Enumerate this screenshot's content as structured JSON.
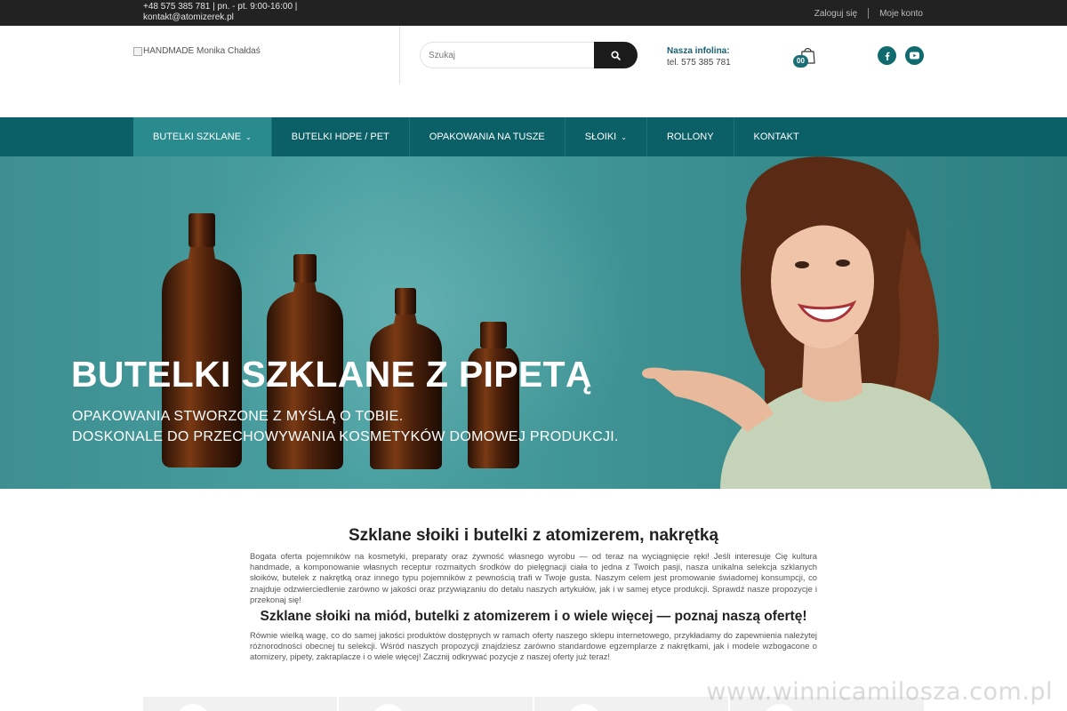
{
  "topbar": {
    "contact_line1": "+48 575 385 781 | pn. - pt. 9:00-16:00 |",
    "contact_line2": "kontakt@atomizerek.pl",
    "login": "Zaloguj się",
    "account": "Moje konto"
  },
  "header": {
    "logo_alt": "HANDMADE Monika Chałdaś",
    "search_placeholder": "Szukaj",
    "infolina_label": "Nasza infolina:",
    "infolina_phone": "tel. 575 385 781",
    "cart_count": "00",
    "social": [
      "facebook-icon",
      "youtube-icon"
    ]
  },
  "nav": {
    "items": [
      {
        "label": "BUTELKI SZKLANE",
        "has_dropdown": true,
        "active": true
      },
      {
        "label": "BUTELKI HDPE / PET",
        "has_dropdown": false,
        "active": false
      },
      {
        "label": "OPAKOWANIA NA TUSZE",
        "has_dropdown": false,
        "active": false
      },
      {
        "label": "SŁOIKI",
        "has_dropdown": true,
        "active": false
      },
      {
        "label": "ROLLONY",
        "has_dropdown": false,
        "active": false
      },
      {
        "label": "KONTAKT",
        "has_dropdown": false,
        "active": false
      }
    ]
  },
  "hero": {
    "title": "BUTELKI SZKLANE Z PIPETĄ",
    "subtitle_line1": "OPAKOWANIA STWORZONE Z MYŚLĄ O TOBIE.",
    "subtitle_line2": "DOSKONALE DO PRZECHOWYWANIA KOSMETYKÓW DOMOWEJ PRODUKCJI."
  },
  "content": {
    "heading": "Szklane słoiki i butelki z atomizerem, nakrętką",
    "paragraph1": "Bogata oferta pojemników na kosmetyki, preparaty oraz żywność własnego wyrobu — od teraz na wyciągnięcie ręki! Jeśli interesuje Cię kultura handmade, a komponowanie własnych receptur rozmaitych środków do pielęgnacji ciała to jedna z Twoich pasji, nasza unikalna selekcja szklanych słoików, butelek z nakrętką oraz innego typu pojemników z pewnością trafi w Twoje gusta. Naszym celem jest promowanie świadomej konsumpcji, co znajduje odzwierciedlenie zarówno w jakości oraz przywiązaniu do detalu naszych artykułów, jak i w samej etyce produkcji. Sprawdź nasze propozycje i przekonaj się!",
    "subheading": "Szklane słoiki na miód, butelki z atomizerem i o wiele więcej — poznaj naszą ofertę!",
    "paragraph2": "Równie wielką wagę, co do samej jakości produktów dostępnych w ramach oferty naszego sklepu internetowego, przykładamy do zapewnienia należytej różnorodności obecnej tu selekcji. Wśród naszych propozycji znajdziesz zarówno standardowe egzemplarze z nakrętkami, jak i modele wzbogacone o atomizery, pipety, zakraplacze i o wiele więcej! Zacznij odkrywać pozycje z naszej oferty już teraz!"
  },
  "watermark": "www.winnicamilosza.com.pl",
  "colors": {
    "topbar": "#222222",
    "nav": "#0b5f66",
    "nav_active": "#2a8b8f",
    "accent": "#1b6d77"
  }
}
